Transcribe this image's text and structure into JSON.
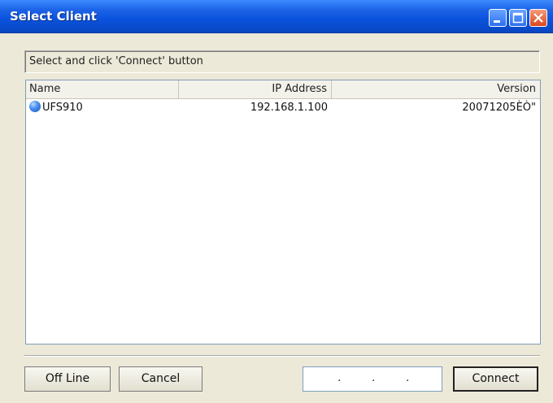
{
  "window": {
    "title": "Select Client"
  },
  "status": {
    "message": "Select and click 'Connect' button"
  },
  "list": {
    "columns": [
      "Name",
      "IP Address",
      "Version"
    ],
    "rows": [
      {
        "name": "UFS910",
        "ip": "192.168.1.100",
        "version": "20071205ÈÒ\""
      }
    ]
  },
  "buttons": {
    "offline": "Off Line",
    "cancel": "Cancel",
    "connect": "Connect"
  },
  "ip_input": {
    "separators": [
      ".",
      ".",
      "."
    ]
  },
  "icons": {
    "minimize": "minimize-icon",
    "maximize": "maximize-icon",
    "close": "close-icon",
    "client": "client-globe-icon"
  },
  "colors": {
    "titlebar": "#0a52dd",
    "window_bg": "#ece9d8",
    "close_button": "#d9471f"
  }
}
